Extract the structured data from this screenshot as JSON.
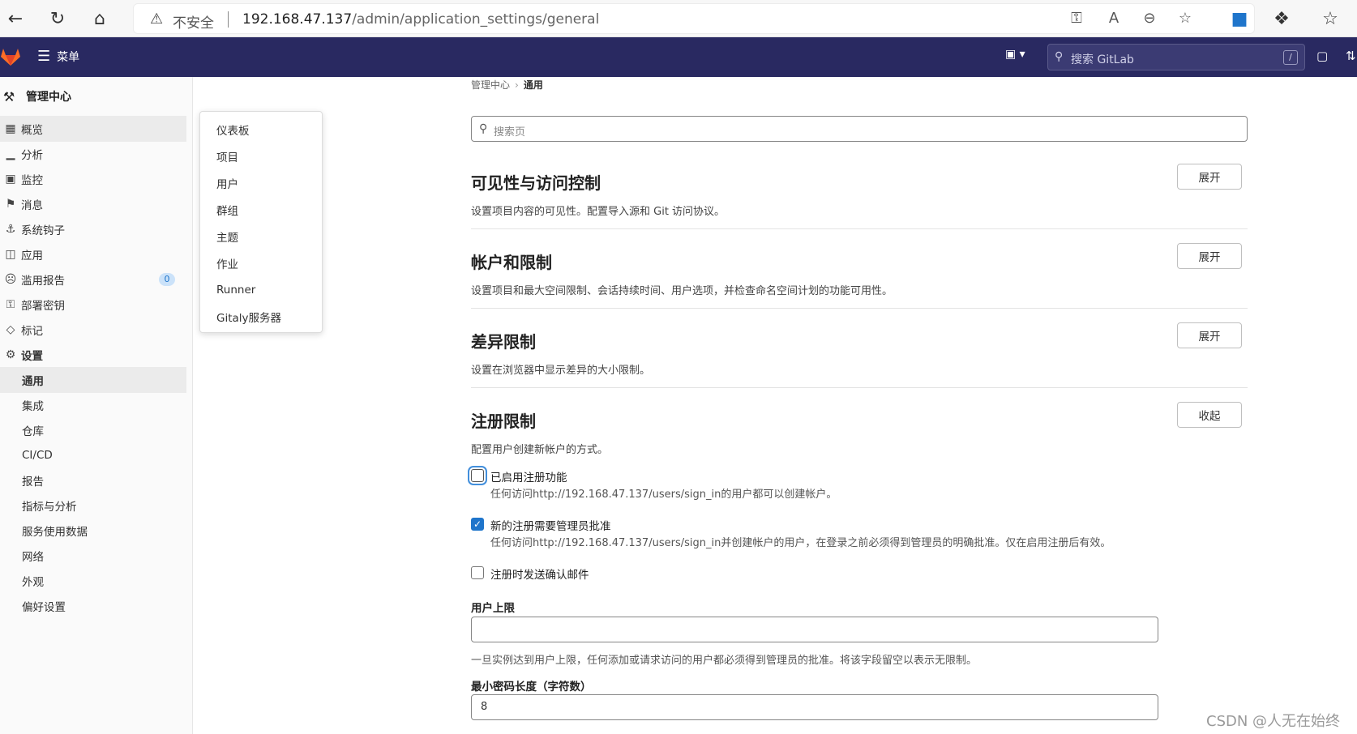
{
  "browser": {
    "security_label": "不安全",
    "url_host": "192.168.47.137",
    "url_path": "/admin/application_settings/general"
  },
  "topnav": {
    "menu_label": "菜单",
    "search_placeholder": "搜索 GitLab",
    "search_shortcut": "/"
  },
  "sidebar": {
    "header": "管理中心",
    "items": [
      {
        "label": "概览"
      },
      {
        "label": "分析"
      },
      {
        "label": "监控"
      },
      {
        "label": "消息"
      },
      {
        "label": "系统钩子"
      },
      {
        "label": "应用"
      },
      {
        "label": "滥用报告",
        "badge": "0"
      },
      {
        "label": "部署密钥"
      },
      {
        "label": "标记"
      },
      {
        "label": "设置"
      }
    ],
    "settings_sub": [
      "通用",
      "集成",
      "仓库",
      "CI/CD",
      "报告",
      "指标与分析",
      "服务使用数据",
      "网络",
      "外观",
      "偏好设置"
    ]
  },
  "flyout": {
    "items": [
      "仪表板",
      "项目",
      "用户",
      "群组",
      "主题",
      "作业",
      "Runner",
      "Gitaly服务器"
    ]
  },
  "breadcrumb": {
    "parent": "管理中心",
    "current": "通用"
  },
  "page_search": {
    "placeholder": "搜索页"
  },
  "sections": [
    {
      "title": "可见性与访问控制",
      "desc": "设置项目内容的可见性。配置导入源和 Git 访问协议。",
      "button": "展开"
    },
    {
      "title": "帐户和限制",
      "desc": "设置项目和最大空间限制、会话持续时间、用户选项，并检查命名空间计划的功能可用性。",
      "button": "展开"
    },
    {
      "title": "差异限制",
      "desc": "设置在浏览器中显示差异的大小限制。",
      "button": "展开"
    },
    {
      "title": "注册限制",
      "desc": "配置用户创建新帐户的方式。",
      "button": "收起"
    }
  ],
  "signup": {
    "enabled_label": "已启用注册功能",
    "enabled_help": "任何访问http://192.168.47.137/users/sign_in的用户都可以创建帐户。",
    "enabled_checked": false,
    "approval_label": "新的注册需要管理员批准",
    "approval_help": "任何访问http://192.168.47.137/users/sign_in并创建帐户的用户，在登录之前必须得到管理员的明确批准。仅在启用注册后有效。",
    "approval_checked": true,
    "confirm_label": "注册时发送确认邮件",
    "confirm_checked": false,
    "user_cap_label": "用户上限",
    "user_cap_value": "",
    "user_cap_help": "一旦实例达到用户上限，任何添加或请求访问的用户都必须得到管理员的批准。将该字段留空以表示无限制。",
    "min_pw_label": "最小密码长度（字符数）",
    "min_pw_value": "8"
  },
  "watermark": "CSDN @人无在始终"
}
